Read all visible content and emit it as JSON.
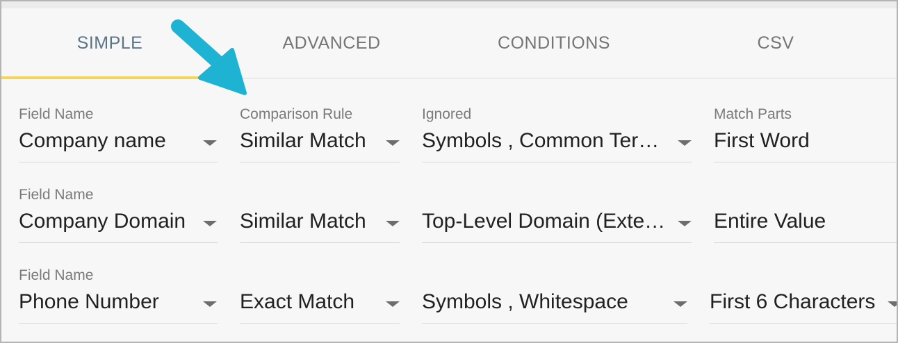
{
  "tabs": [
    {
      "label": "SIMPLE",
      "active": true
    },
    {
      "label": "ADVANCED",
      "active": false
    },
    {
      "label": "CONDITIONS",
      "active": false
    },
    {
      "label": "CSV",
      "active": false
    }
  ],
  "rows": [
    {
      "field_label": "Field Name",
      "field_value": "Company name",
      "comparison_label": "Comparison Rule",
      "comparison_value": "Similar Match",
      "ignored_label": "Ignored",
      "ignored_value": "Symbols , Common Ter…",
      "match_label": "Match Parts",
      "match_value": "First Word"
    },
    {
      "field_label": "Field Name",
      "field_value": "Company Domain",
      "comparison_value": "Similar Match",
      "ignored_value": "Top-Level Domain (Exte…",
      "match_value": "Entire Value"
    },
    {
      "field_label": "Field Name",
      "field_value": "Phone Number",
      "comparison_value": "Exact Match",
      "ignored_value": "Symbols , Whitespace",
      "match_value": "First 6 Characters"
    }
  ],
  "icons": {
    "callout_arrow": "arrow-pointer-icon",
    "dropdown": "caret-down-icon"
  },
  "colors": {
    "active_tab_underline": "#f4d557",
    "active_tab_text": "#5c7587",
    "callout_arrow": "#1eb3d3"
  }
}
